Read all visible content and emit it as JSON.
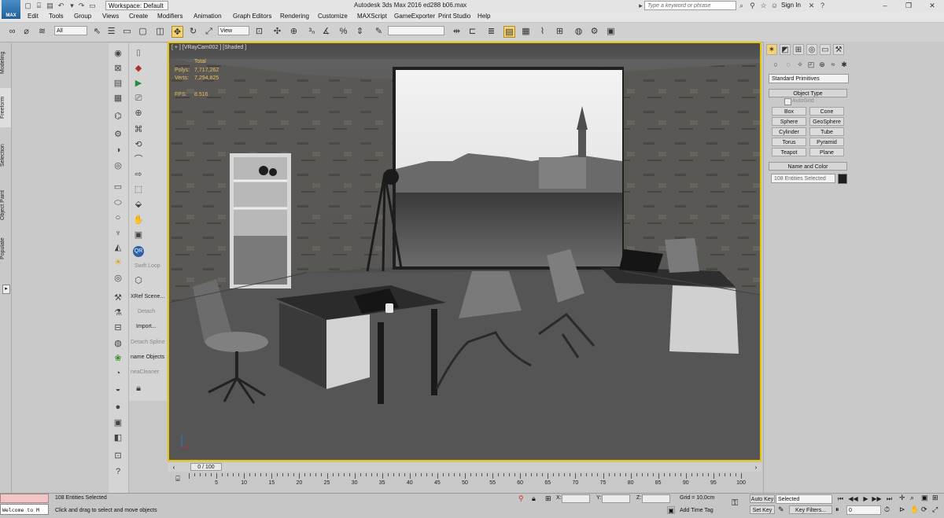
{
  "titlebar": {
    "workspace_label": "Workspace: Default",
    "app_title": "Autodesk 3ds Max 2016",
    "file_name": "ed288 b06.max",
    "search_placeholder": "Type a keyword or phrase",
    "sign_in": "Sign In",
    "logo_text": "MAX"
  },
  "menu": [
    "Edit",
    "Tools",
    "Group",
    "Views",
    "Create",
    "Modifiers",
    "Animation",
    "Graph Editors",
    "Rendering",
    "Customize",
    "MAXScript",
    "GameExporter",
    "Print Studio",
    "Help"
  ],
  "toolbar": {
    "selection_filter": "All",
    "ref_coord": "View",
    "named_selection": ""
  },
  "left_tabs": [
    "Modeling",
    "Freeform",
    "Selection",
    "Object Paint",
    "Populate"
  ],
  "tool_column": {
    "labels": [
      {
        "text": "Swift Loop",
        "dim": true
      },
      {
        "text": "XRef Scene...",
        "dim": false
      },
      {
        "text": "Detach",
        "dim": true
      },
      {
        "text": "Import...",
        "dim": false
      },
      {
        "text": "Detach Spline",
        "dim": true
      },
      {
        "text": "name Objects",
        "dim": false
      },
      {
        "text": "neaCleaner",
        "dim": true
      }
    ],
    "qr_label": "QR"
  },
  "viewport": {
    "label": "[ + ] [VRayCam002 ] [Shaded ]",
    "stats": {
      "total_label": "Total",
      "polys_label": "Polys:",
      "polys_value": "7,717,262",
      "verts_label": "Verts:",
      "verts_value": "7,294,825",
      "fps_label": "FPS:",
      "fps_value": "8.516"
    }
  },
  "command_panel": {
    "dropdown": "Standard Primitives",
    "object_type_title": "Object Type",
    "autogrid": "AutoGrid",
    "primitives": [
      "Box",
      "Cone",
      "Sphere",
      "GeoSphere",
      "Cylinder",
      "Tube",
      "Torus",
      "Pyramid",
      "Teapot",
      "Plane"
    ],
    "name_color_title": "Name and Color",
    "name_field": "108 Entities Selected",
    "object_color": "#1e1e1e"
  },
  "timeline": {
    "frame_display": "0 / 100",
    "ticks": [
      "5",
      "10",
      "15",
      "20",
      "25",
      "30",
      "35",
      "40",
      "45",
      "50",
      "55",
      "60",
      "65",
      "70",
      "75",
      "80",
      "85",
      "90",
      "95",
      "100"
    ]
  },
  "status": {
    "selection": "108 Entities Selected",
    "prompt": "Click and drag to select and move objects",
    "welcome": "Welcome to M",
    "x_label": "X:",
    "y_label": "Y:",
    "z_label": "Z:",
    "grid": "Grid = 10,0cm",
    "add_time_tag": "Add Time Tag",
    "auto_key": "Auto Key",
    "set_key": "Set Key",
    "key_mode": "Selected",
    "key_filters": "Key Filters...",
    "current_frame": "0"
  },
  "colors": {
    "viewport_border": "#e6c700",
    "stats_text": "#e8c060"
  }
}
